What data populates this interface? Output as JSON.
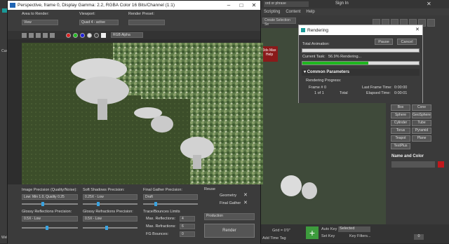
{
  "max": {
    "menu": [
      "Scripting",
      "Content",
      "Help"
    ],
    "search_text": "ord or phrase",
    "sign_in": "Sign In",
    "selection_set": "Create Selection Se",
    "side_max_help": "3ds Max Help",
    "autogrid": {
      "items": [
        "Box",
        "Cone",
        "Sphere",
        "GeoSphere",
        "Cylinder",
        "Tube",
        "Torus",
        "Pyramid",
        "Teapot",
        "Plane",
        "TextPlus"
      ]
    },
    "name_and_color": "Name and Color",
    "grid_readout": "Grid = 0'0\"",
    "add_time_tag": "Add Time Tag",
    "auto_key": "Auto Key",
    "set_key": "Set Key",
    "selected": "Selected",
    "key_filters": "Key Filters...",
    "frame_number": "0",
    "welcome": "Welco",
    "left_label": "Custom"
  },
  "frame_window": {
    "title": "Perspective, frame 0, Display Gamma: 2.2, RGBA Color 16 Bits/Channel (1:1)",
    "area_to_render_label": "Area to Render:",
    "area_to_render_value": "View",
    "viewport_label": "Viewport:",
    "viewport_value": "Quad 4 - active",
    "render_preset_label": "Render Preset:",
    "channel_value": "RGB Alpha",
    "image_precision_label": "Image Precision (Quality/Noise):",
    "image_precision_value": "Low: Min 1.0, Quality 0.25",
    "soft_shadows_label": "Soft Shadows Precision:",
    "soft_shadows_value": "0.25X - Low",
    "final_gather_label": "Final Gather Precision:",
    "final_gather_value": "Draft",
    "reuse_label": "Reuse",
    "geometry_label": "Geometry",
    "final_gather_reuse_label": "Final Gather",
    "glossy_reflections_label": "Glossy Reflections Precision:",
    "glossy_reflections_value": "0.5X - Low",
    "glossy_refractions_label": "Glossy Refractions Precision:",
    "glossy_refractions_value": "0.5X - Low",
    "trace_label": "Trace/Bounces Limits",
    "max_reflections_label": "Max. Reflections:",
    "max_reflections_value": "4",
    "max_refractions_label": "Max. Refractions:",
    "max_refractions_value": "6",
    "fg_bounces_label": "FG Bounces:",
    "fg_bounces_value": "0",
    "production_value": "Production",
    "render_button": "Render"
  },
  "rendering_dialog": {
    "title": "Rendering",
    "pause": "Pause",
    "cancel": "Cancel",
    "total_animation_label": "Total Animation:",
    "total_progress": 0.0,
    "current_task_label": "Current Task:",
    "current_task_value": "56.9% Rendering...",
    "current_progress": 0.569,
    "common_parameters": "Common Parameters",
    "rendering_progress_label": "Rendering Progress:",
    "frame_label": "Frame #",
    "frame_value": "0",
    "of_text": "1 of 1",
    "total_label": "Total",
    "last_frame_time_label": "Last Frame Time:",
    "last_frame_time_value": "0:00:00",
    "elapsed_time_label": "Elapsed Time:",
    "elapsed_time_value": "0:00:01"
  }
}
